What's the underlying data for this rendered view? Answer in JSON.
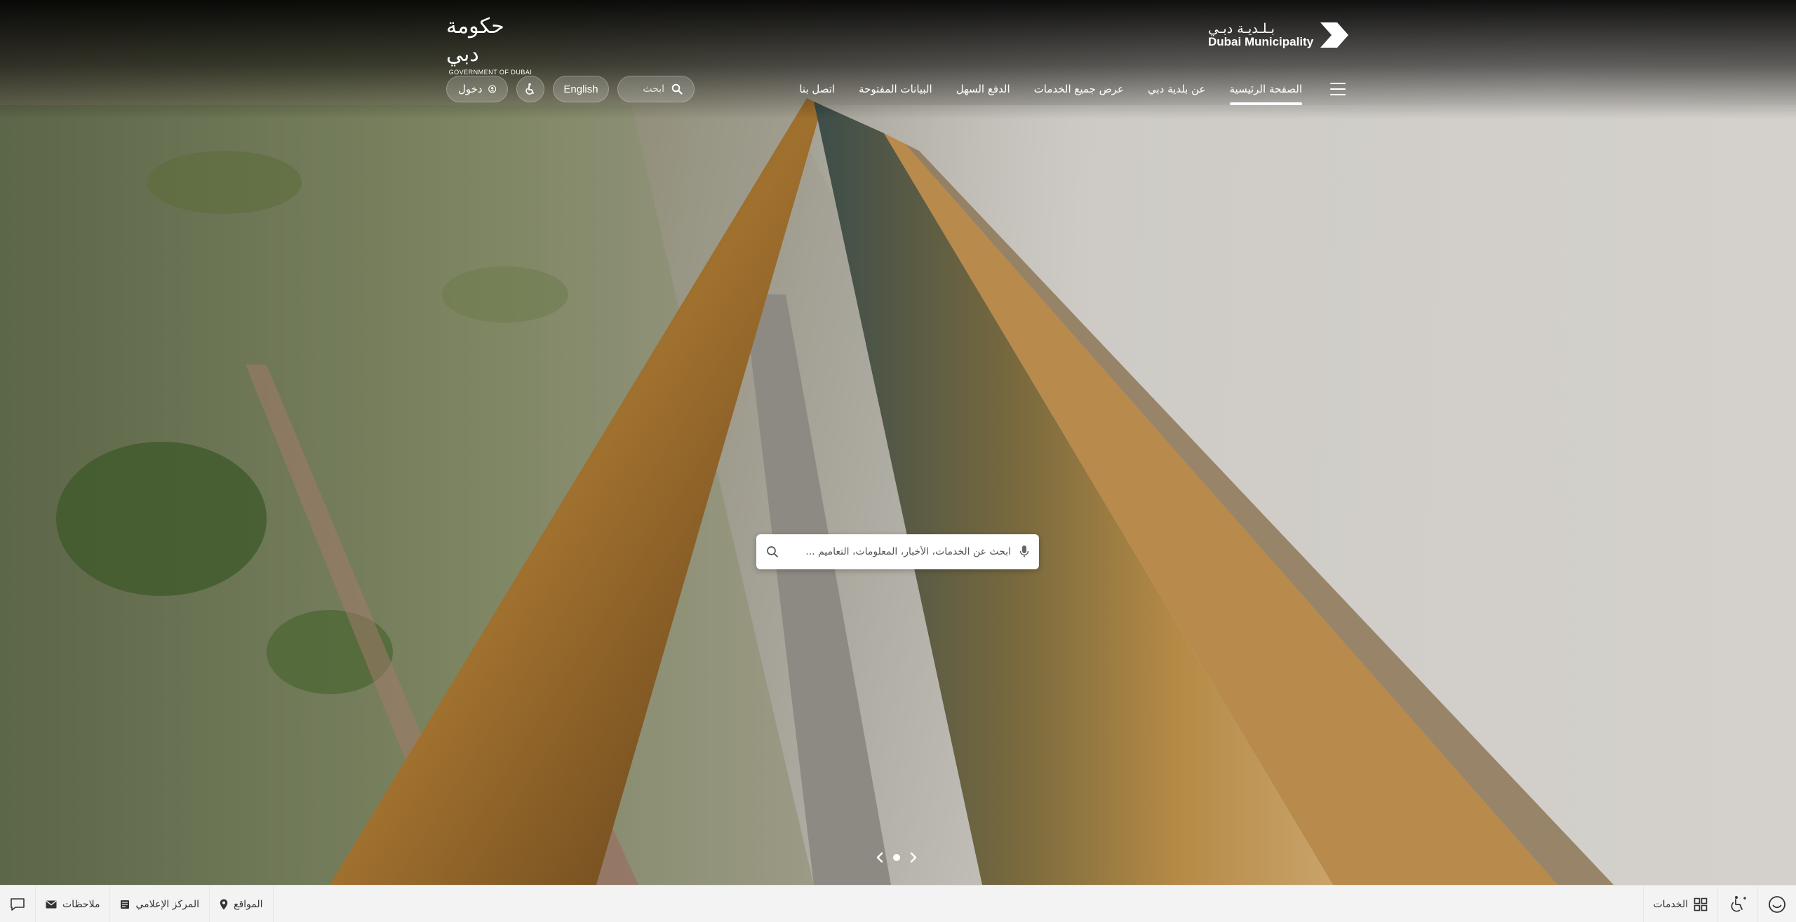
{
  "header": {
    "dm_logo_ar": "بـلـديـة دبـي",
    "dm_logo_en": "Dubai Municipality",
    "gov_logo_ar": "حكومة دبي",
    "gov_logo_en": "GOVERNMENT OF DUBAI"
  },
  "nav": {
    "items": [
      {
        "label": "الصفحة الرئيسية",
        "active": true
      },
      {
        "label": "عن بلدية دبي"
      },
      {
        "label": "عرض جميع الخدمات"
      },
      {
        "label": "الدفع السهل"
      },
      {
        "label": "البيانات المفتوحة"
      },
      {
        "label": "اتصل بنا"
      }
    ]
  },
  "tools": {
    "search_placeholder": "ابحث",
    "language_label": "English",
    "login_label": "دخول"
  },
  "hero_search": {
    "placeholder": "ابحث عن الخدمات، الأخبار، المعلومات، التعاميم ..."
  },
  "bottom_bar": {
    "feedback_label": "ملاحظات",
    "media_center_label": "المركز الإعلامي",
    "locations_label": "المواقع",
    "services_label": "الخدمات"
  },
  "colors": {
    "nav_text": "#ffffff",
    "bottom_bar_bg": "#f3f3f3"
  }
}
